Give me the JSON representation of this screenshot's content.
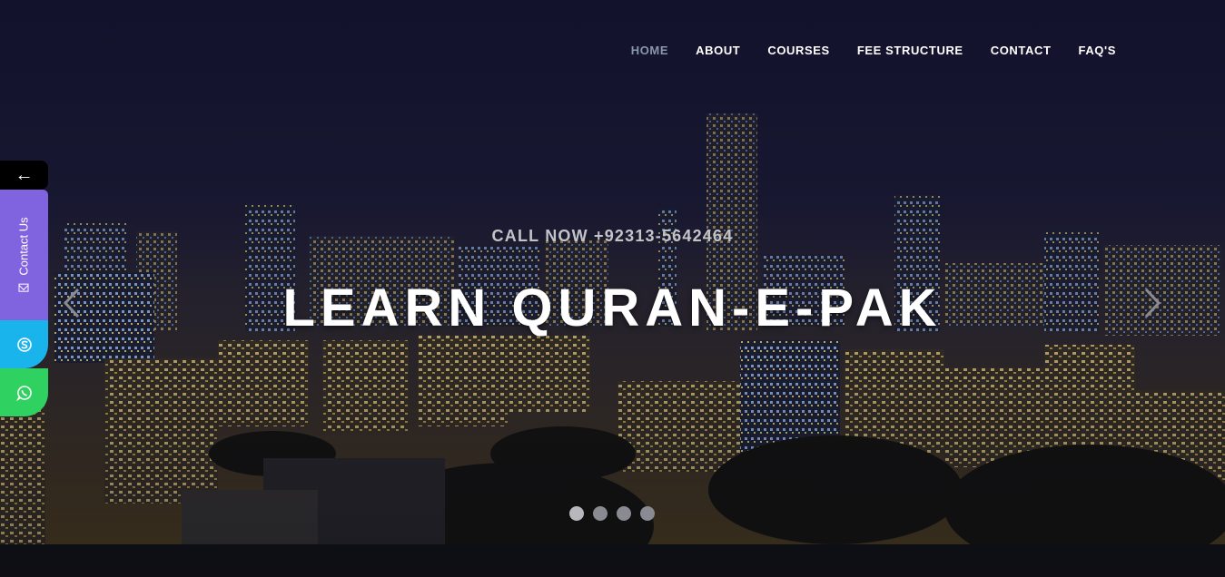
{
  "nav": {
    "items": [
      {
        "label": "HOME",
        "active": true
      },
      {
        "label": "ABOUT",
        "active": false
      },
      {
        "label": "COURSES",
        "active": false
      },
      {
        "label": "FEE STRUCTURE",
        "active": false
      },
      {
        "label": "CONTACT",
        "active": false
      },
      {
        "label": "FAQ'S",
        "active": false
      }
    ]
  },
  "hero": {
    "call_now": "CALL NOW +92313-5642464",
    "headline": "LEARN QURAN-E-PAK",
    "prev_icon": "chevron-left-icon",
    "next_icon": "chevron-right-icon",
    "slides_count": 4,
    "active_slide": 1
  },
  "side_widget": {
    "toggle_icon": "arrow-left-icon",
    "toggle_glyph": "←",
    "contact_label": "Contact Us",
    "contact_icon": "mail-icon",
    "skype_icon": "skype-icon",
    "whatsapp_icon": "whatsapp-icon"
  },
  "colors": {
    "nav_active": "#8a96ad",
    "contact_tab": "#8063de",
    "skype": "#1ab4ec",
    "whatsapp": "#2fd160"
  }
}
